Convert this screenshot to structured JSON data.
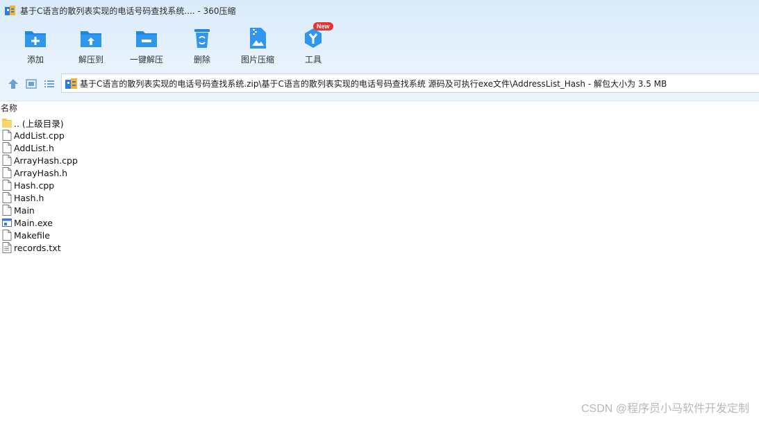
{
  "window": {
    "title": "基于C语言的散列表实现的电话号码查找系统.... - 360压缩"
  },
  "toolbar": {
    "items": [
      {
        "label": "添加",
        "icon": "add-folder-icon"
      },
      {
        "label": "解压到",
        "icon": "extract-to-icon"
      },
      {
        "label": "一键解压",
        "icon": "one-click-extract-icon"
      },
      {
        "label": "删除",
        "icon": "recycle-bin-icon"
      },
      {
        "label": "图片压缩",
        "icon": "image-compress-icon"
      },
      {
        "label": "工具",
        "icon": "tools-icon",
        "badge": "New"
      }
    ]
  },
  "address": {
    "path": "基于C语言的散列表实现的电话号码查找系统.zip\\基于C语言的散列表实现的电话号码查找系统 源码及可执行exe文件\\AddressList_Hash - 解包大小为 3.5 MB"
  },
  "list": {
    "column_name": "名称",
    "items": [
      {
        "name": ".. (上级目录)",
        "type": "folder"
      },
      {
        "name": "AddList.cpp",
        "type": "file"
      },
      {
        "name": "AddList.h",
        "type": "file"
      },
      {
        "name": "ArrayHash.cpp",
        "type": "file"
      },
      {
        "name": "ArrayHash.h",
        "type": "file"
      },
      {
        "name": "Hash.cpp",
        "type": "file"
      },
      {
        "name": "Hash.h",
        "type": "file"
      },
      {
        "name": "Main",
        "type": "file"
      },
      {
        "name": "Main.exe",
        "type": "exe"
      },
      {
        "name": "Makefile",
        "type": "file"
      },
      {
        "name": "records.txt",
        "type": "text"
      }
    ]
  },
  "watermark": "CSDN @程序员小马软件开发定制",
  "colors": {
    "accent": "#1e88e5",
    "badge": "#e8332f",
    "folder": "#f5c542"
  }
}
